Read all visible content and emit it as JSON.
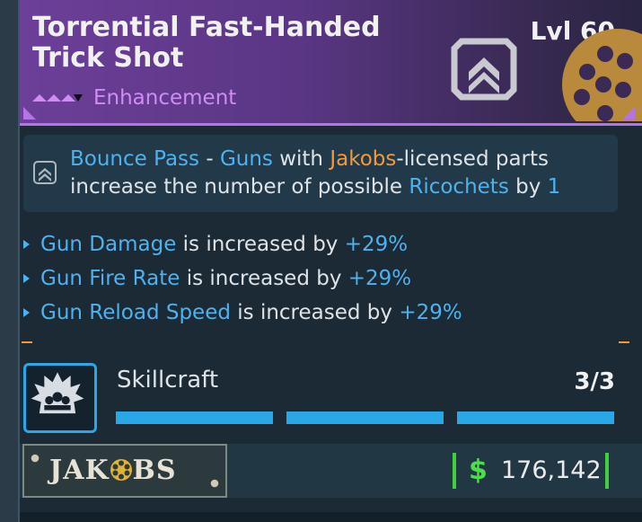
{
  "item": {
    "title": "Torrential Fast-Handed Trick Shot",
    "level": "Lvl 60",
    "type": "Enhancement"
  },
  "perk": {
    "name": "Bounce Pass",
    "sep": " - ",
    "guns": "Guns",
    "with": " with ",
    "manufacturer": "Jakobs",
    "rest1": "-licensed parts increase the number of possible ",
    "ricochets": "Ricochets",
    "by": " by ",
    "amount": "1"
  },
  "stats": [
    {
      "name": "Gun Damage",
      "text": " is increased by ",
      "value": "+29%"
    },
    {
      "name": "Gun Fire Rate",
      "text": " is increased by ",
      "value": "+29%"
    },
    {
      "name": "Gun Reload Speed",
      "text": " is increased by ",
      "value": "+29%"
    }
  ],
  "skillcraft": {
    "label": "Skillcraft",
    "count": "3/3",
    "filled": 3,
    "total": 3
  },
  "footer": {
    "manufacturer_left": "JAK",
    "manufacturer_right": "BS",
    "currency_symbol": "$",
    "price": "176,142"
  },
  "colors": {
    "accent_blue": "#4db2ee",
    "rarity_purple": "#b573e8",
    "manufacturer_orange": "#f29a3a",
    "money_green": "#3fcf3f"
  }
}
